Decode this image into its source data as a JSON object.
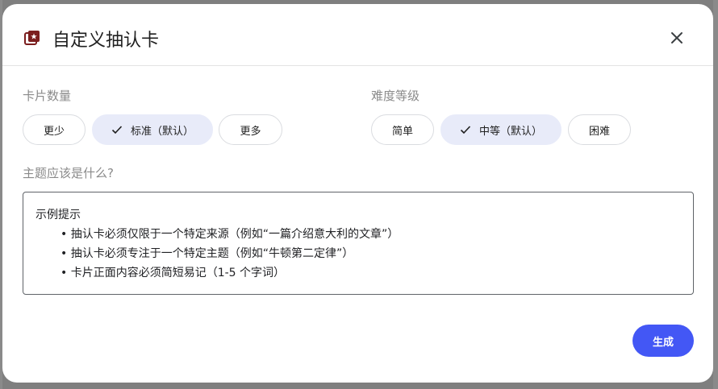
{
  "dialog": {
    "title": "自定义抽认卡",
    "close_icon": "close-icon",
    "title_icon": "flashcard-icon",
    "accent_color": "#7b1e1e"
  },
  "card_count": {
    "label": "卡片数量",
    "options": [
      {
        "label": "更少",
        "selected": false
      },
      {
        "label": "标准（默认）",
        "selected": true
      },
      {
        "label": "更多",
        "selected": false
      }
    ]
  },
  "difficulty": {
    "label": "难度等级",
    "options": [
      {
        "label": "简单",
        "selected": false
      },
      {
        "label": "中等（默认）",
        "selected": true
      },
      {
        "label": "困难",
        "selected": false
      }
    ]
  },
  "topic": {
    "label": "主题应该是什么?",
    "heading": "示例提示",
    "bullets": [
      "• 抽认卡必须仅限于一个特定来源（例如“一篇介绍意大利的文章”）",
      "• 抽认卡必须专注于一个特定主题（例如“牛顿第二定律”）",
      "• 卡片正面内容必须简短易记（1-5 个字词）"
    ]
  },
  "actions": {
    "generate_label": "生成",
    "generate_color": "#4357f5"
  },
  "colors": {
    "selected_option_bg": "#e8ebf9",
    "muted_label": "#8a8a8a"
  }
}
